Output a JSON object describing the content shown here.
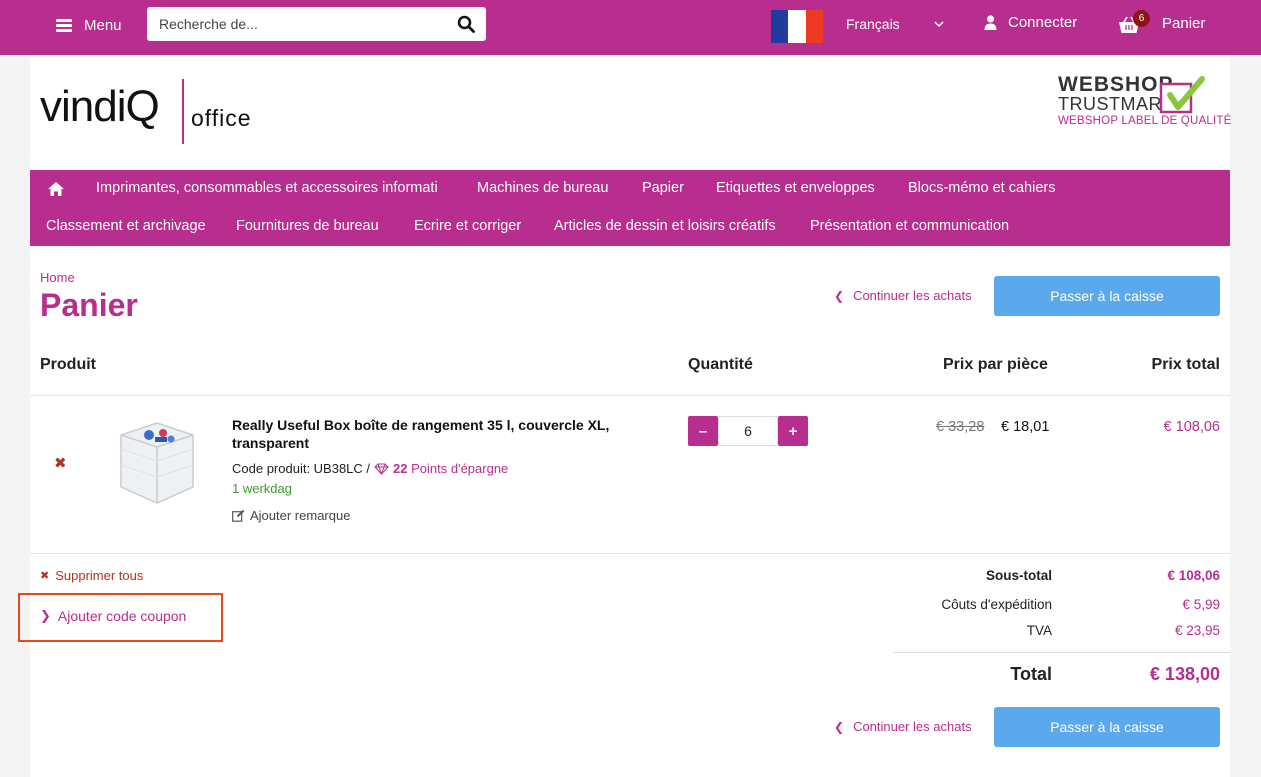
{
  "topbar": {
    "menu_label": "Menu",
    "search_placeholder": "Recherche de...",
    "language": "Français",
    "login_label": "Connecter",
    "cart_label": "Panier",
    "cart_count": "6",
    "flag_colors": [
      "#1f3c9e",
      "#ffffff",
      "#ef3a23"
    ],
    "brand_color": "#b72e8e"
  },
  "header": {
    "logo_word": "vindiQ",
    "logo_sub": "office",
    "trustmark_line1": "WEBSHOP",
    "trustmark_line2": "TRUSTMARK",
    "trustmark_line3": "WEBSHOP LABEL DE QUALITÉ"
  },
  "nav": {
    "row1": [
      "Imprimantes, consommables et accessoires informati",
      "Machines de bureau",
      "Papier",
      "Etiquettes et enveloppes",
      "Blocs-mémo et cahiers"
    ],
    "row2": [
      "Classement et archivage",
      "Fournitures de bureau",
      "Ecrire et corriger",
      "Articles de dessin et loisirs créatifs",
      "Présentation et communication"
    ]
  },
  "page": {
    "breadcrumb": "Home",
    "title": "Panier",
    "continue_label": "Continuer les achats",
    "checkout_label": "Passer à la caisse"
  },
  "table": {
    "headers": {
      "product": "Produit",
      "quantity": "Quantité",
      "unit_price": "Prix par pièce",
      "total_price": "Prix total"
    }
  },
  "item": {
    "name": "Really Useful Box boîte de rangement 35 l, couvercle XL, transparent",
    "code_label": "Code produit: UB38LC /",
    "points_value": "22",
    "points_label": "Points d'épargne",
    "delivery": "1 werkdag",
    "remark_label": "Ajouter remarque",
    "quantity": "6",
    "old_price": "€ 33,28",
    "price": "€ 18,01",
    "line_total": "€ 108,06"
  },
  "actions": {
    "delete_all": "Supprimer tous",
    "coupon": "Ajouter code coupon"
  },
  "summary": {
    "subtotal_label": "Sous-total",
    "subtotal": "€ 108,06",
    "shipping_label": "Côuts d'expédition",
    "shipping": "€ 5,99",
    "vat_label": "TVA",
    "vat": "€ 23,95",
    "total_label": "Total",
    "total": "€ 138,00"
  }
}
